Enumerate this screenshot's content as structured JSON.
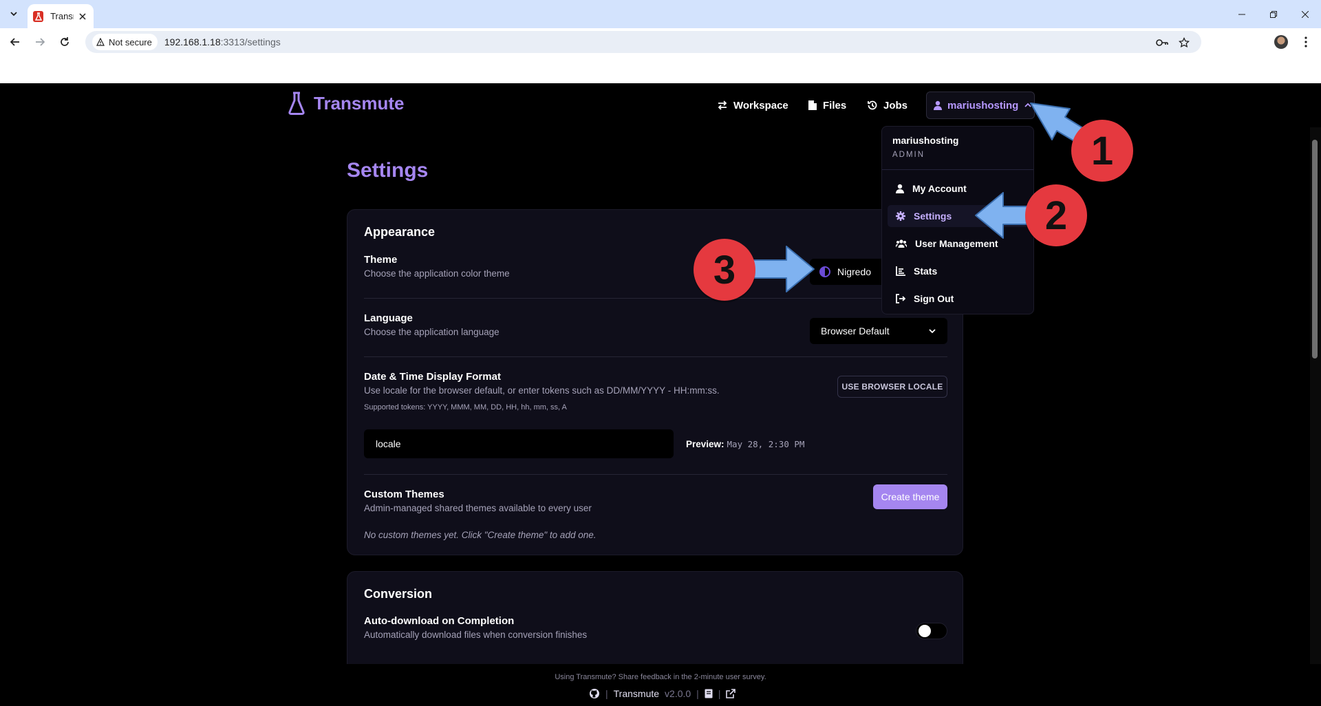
{
  "browser": {
    "tab_title": "Transmute",
    "security_label": "Not secure",
    "url_host": "192.168.1.18",
    "url_rest": ":3313/settings"
  },
  "app": {
    "brand": "Transmute",
    "nav": {
      "workspace": "Workspace",
      "files": "Files",
      "jobs": "Jobs",
      "user": "mariushosting"
    },
    "menu": {
      "username": "mariushosting",
      "role": "ADMIN",
      "items": [
        "My Account",
        "Settings",
        "User Management",
        "Stats",
        "Sign Out"
      ]
    },
    "page_title": "Settings",
    "appearance": {
      "heading": "Appearance",
      "theme_title": "Theme",
      "theme_desc": "Choose the application color theme",
      "theme_value": "Nigredo",
      "language_title": "Language",
      "language_desc": "Choose the application language",
      "language_value": "Browser Default",
      "datetime_title": "Date & Time Display Format",
      "datetime_desc": "Use locale for the browser default, or enter tokens such as DD/MM/YYYY - HH:mm:ss.",
      "datetime_tokens": "Supported tokens: YYYY, MMM, MM, DD, HH, hh, mm, ss, A",
      "datetime_value": "locale",
      "locale_button": "USE BROWSER LOCALE",
      "preview_label": "Preview:",
      "preview_value": "May 28, 2:30 PM",
      "custom_title": "Custom Themes",
      "custom_desc": "Admin-managed shared themes available to every user",
      "create_button": "Create theme",
      "custom_empty": "No custom themes yet. Click \"Create theme\" to add one."
    },
    "conversion": {
      "heading": "Conversion",
      "autodl_title": "Auto-download on Completion",
      "autodl_desc": "Automatically download files when conversion finishes",
      "autodl_enabled": false
    },
    "footer": {
      "survey": "Using Transmute? Share feedback in the 2-minute user survey.",
      "name": "Transmute",
      "version": "v2.0.0"
    }
  },
  "annotations": {
    "badges": [
      "1",
      "2",
      "3"
    ],
    "color_badge": "#e5393f",
    "color_arrow": "#7fb2f0"
  },
  "colors": {
    "accent": "#a586f0",
    "background": "#000000",
    "card": "#0f0e1a"
  }
}
